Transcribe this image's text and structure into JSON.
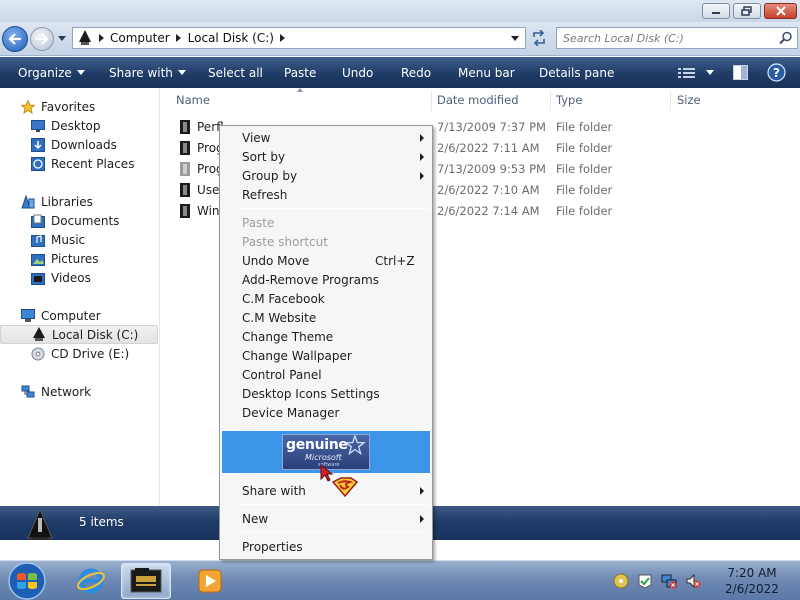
{
  "window": {
    "controls": {
      "minimize": "minimize",
      "maximize": "maximize",
      "close": "close"
    }
  },
  "address": {
    "crumbs": [
      "Computer",
      "Local Disk (C:)"
    ],
    "search_placeholder": "Search Local Disk (C:)"
  },
  "toolbar": {
    "organize": "Organize",
    "share_with": "Share with",
    "select_all": "Select all",
    "paste": "Paste",
    "undo": "Undo",
    "redo": "Redo",
    "menu_bar": "Menu bar",
    "details_pane": "Details pane"
  },
  "nav": {
    "favorites": "Favorites",
    "desktop": "Desktop",
    "downloads": "Downloads",
    "recent_places": "Recent Places",
    "libraries": "Libraries",
    "documents": "Documents",
    "music": "Music",
    "pictures": "Pictures",
    "videos": "Videos",
    "computer": "Computer",
    "local_disk": "Local Disk (C:)",
    "cd_drive": "CD Drive (E:)",
    "network": "Network"
  },
  "columns": {
    "name": "Name",
    "date": "Date modified",
    "type": "Type",
    "size": "Size"
  },
  "files": [
    {
      "name": "Perfl",
      "date": "7/13/2009 7:37 PM",
      "type": "File folder"
    },
    {
      "name": "Prog",
      "date": "2/6/2022 7:11 AM",
      "type": "File folder"
    },
    {
      "name": "Prog",
      "date": "7/13/2009 9:53 PM",
      "type": "File folder"
    },
    {
      "name": "User",
      "date": "2/6/2022 7:10 AM",
      "type": "File folder"
    },
    {
      "name": "Win",
      "date": "2/6/2022 7:14 AM",
      "type": "File folder"
    }
  ],
  "context_menu": {
    "view": "View",
    "sort_by": "Sort by",
    "group_by": "Group by",
    "refresh": "Refresh",
    "paste": "Paste",
    "paste_shortcut": "Paste shortcut",
    "undo_move": "Undo Move",
    "undo_shortcut": "Ctrl+Z",
    "add_remove": "Add-Remove Programs",
    "cm_facebook": "C.M Facebook",
    "cm_website": "C.M Website",
    "change_theme": "Change Theme",
    "change_wallpaper": "Change Wallpaper",
    "control_panel": "Control Panel",
    "desktop_icons": "Desktop Icons Settings",
    "device_manager": "Device Manager",
    "genuine_line1": "genuine",
    "genuine_line2": "Microsoft",
    "genuine_line3": "software",
    "share_with": "Share with",
    "new": "New",
    "properties": "Properties"
  },
  "details": {
    "item_count": "5 items"
  },
  "taskbar": {
    "time": "7:20 AM",
    "date": "2/6/2022"
  },
  "colors": {
    "command_bar": "#1f3b66",
    "menu_highlight": "#3d95ea",
    "taskbar": "#6f8ab3"
  }
}
